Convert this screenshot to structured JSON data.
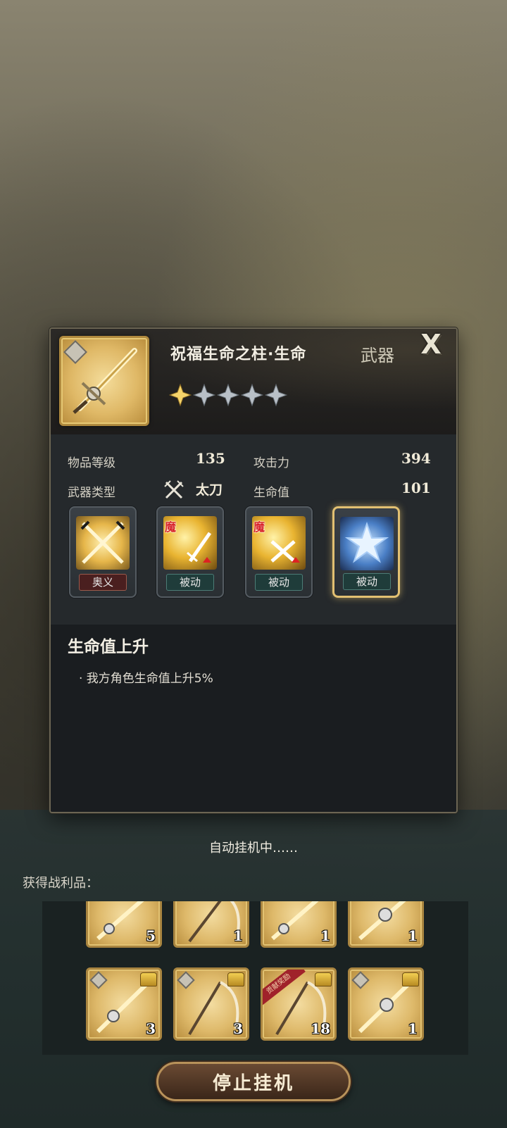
{
  "item": {
    "title": "祝福生命之柱·生命",
    "type": "武器",
    "close_label": "X",
    "stars_filled": 1,
    "stars_total": 5,
    "stats": [
      {
        "label": "物品等级",
        "value": "135"
      },
      {
        "label": "攻击力",
        "value": "394"
      },
      {
        "label": "武器类型",
        "value": "太刀",
        "icon": "crossed-swords-icon"
      },
      {
        "label": "生命值",
        "value": "101"
      }
    ],
    "skills": [
      {
        "tag": "奥义",
        "icon": "crossed-blades-icon",
        "badge": ""
      },
      {
        "tag": "被动",
        "icon": "sword-up-icon",
        "badge": "魔"
      },
      {
        "tag": "被动",
        "icon": "crossed-swords-up-icon",
        "badge": "魔"
      },
      {
        "tag": "被动",
        "icon": "star-burst-icon",
        "badge": "",
        "selected": true
      }
    ],
    "description": {
      "title": "生命值上升",
      "lines": [
        "· 我方角色生命值上升5%"
      ]
    }
  },
  "auto_battle": {
    "status": "自动挂机中……",
    "loot_label": "获得战利品：",
    "loot_rows": [
      [
        {
          "qty": "5",
          "icon": "sword-icon"
        },
        {
          "qty": "1",
          "icon": "scythe-icon"
        },
        {
          "qty": "1",
          "icon": "sword-icon"
        },
        {
          "qty": "1",
          "icon": "sword-icon"
        }
      ],
      [
        {
          "qty": "3",
          "icon": "sword-icon",
          "chest": true
        },
        {
          "qty": "3",
          "icon": "scythe-icon",
          "chest": true
        },
        {
          "qty": "18",
          "icon": "scythe-icon",
          "chest": true,
          "ribbon": "贡献奖励"
        },
        {
          "qty": "1",
          "icon": "sword-icon",
          "chest": true
        }
      ]
    ],
    "stop_label": "停止挂机"
  },
  "colors": {
    "gold_frame": "#b08a3e",
    "panel_dark": "#1e2225",
    "tag_green": "#1f3c3a",
    "tag_red": "#4a1f1f"
  }
}
